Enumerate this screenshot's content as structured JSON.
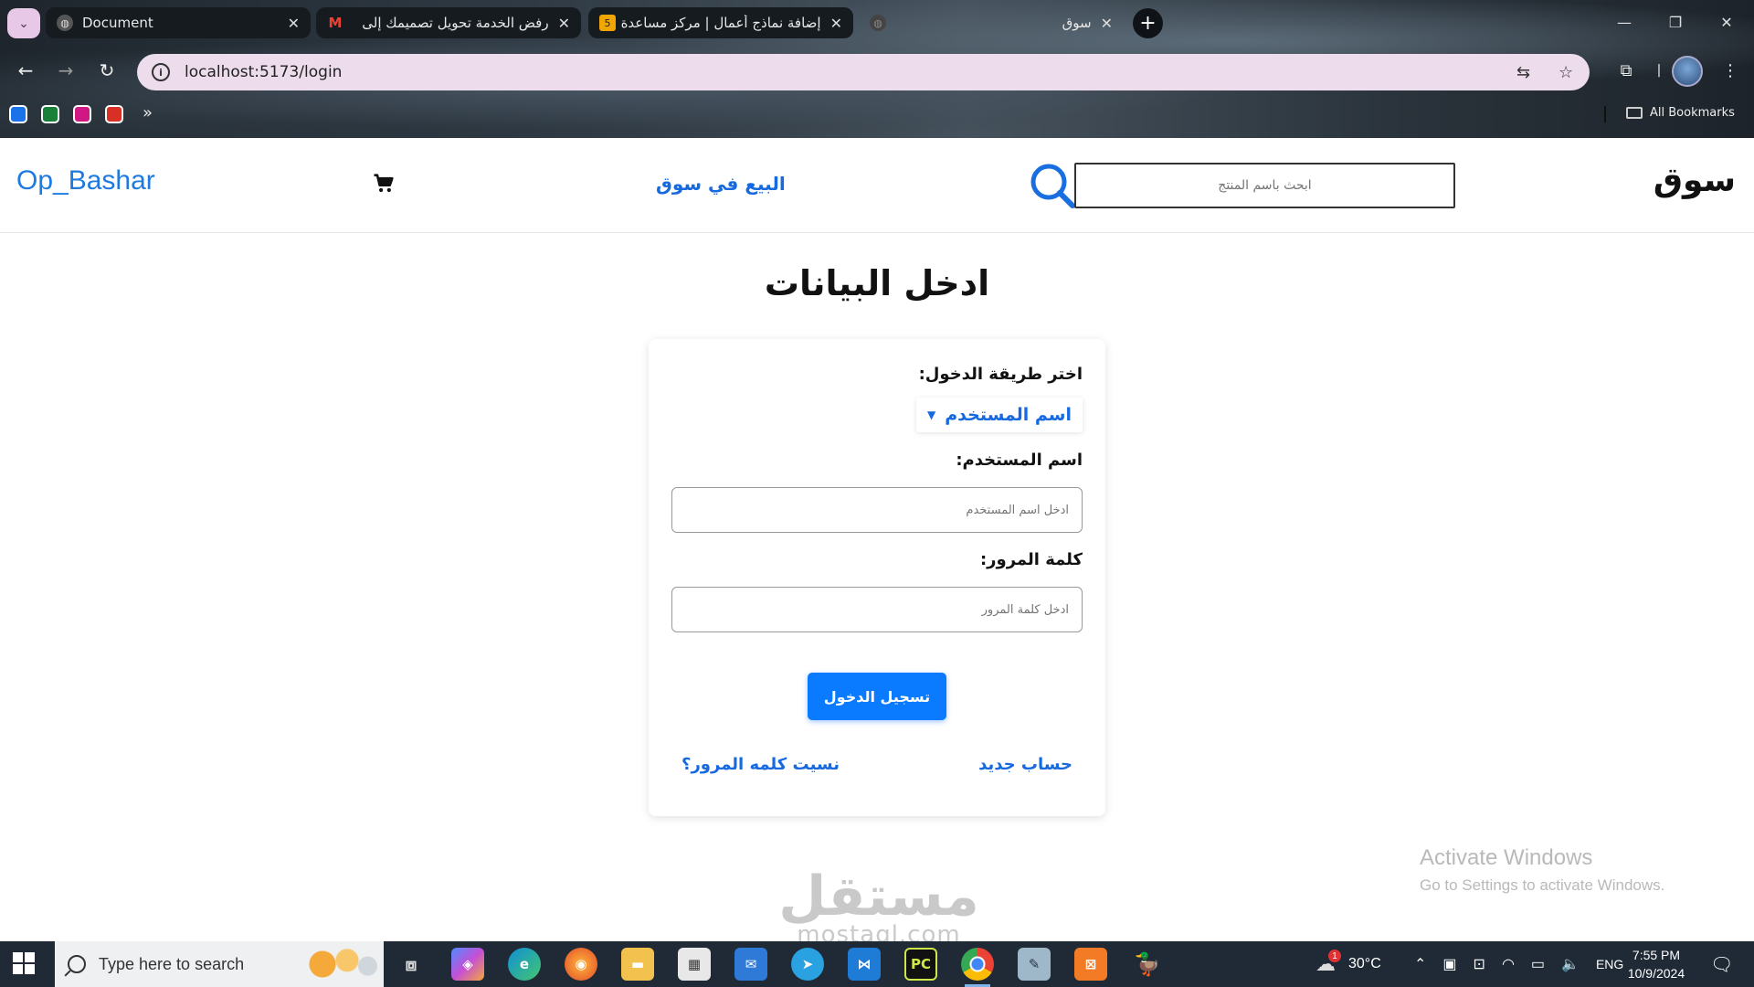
{
  "browser": {
    "tabs": [
      {
        "title": "Document",
        "favicon": "globe-icon"
      },
      {
        "title": "رفض الخدمة تحويل تصميمك إلى",
        "favicon": "gmail-icon"
      },
      {
        "title": "إضافة نماذج أعمال | مركز مساعدة",
        "favicon": "mostaql-icon",
        "badge": "5"
      },
      {
        "title": "سوق",
        "favicon": "globe-icon"
      }
    ],
    "url": "localhost:5173/login",
    "bookmarks_label": "All Bookmarks"
  },
  "header": {
    "brand": "Op_Bashar",
    "sell_link": "البيع في سوق",
    "search_placeholder": "ابحث باسم المنتج",
    "logo": "سوق"
  },
  "login": {
    "page_title": "ادخل البيانات",
    "method_label": "اختر طريقة الدخول:",
    "method_value": "اسم المستخدم",
    "username_label": "اسم المستخدم:",
    "username_placeholder": "ادخل اسم المستخدم",
    "password_label": "كلمة المرور:",
    "password_placeholder": "ادخل كلمة المرور",
    "submit": "تسجيل الدخول",
    "new_account": "حساب جديد",
    "forgot_password": "نسيت كلمه المرور؟"
  },
  "watermark": {
    "arabic": "مستقل",
    "latin": "mostaql.com"
  },
  "windows": {
    "activate_title": "Activate Windows",
    "activate_sub": "Go to Settings to activate Windows.",
    "search_placeholder": "Type here to search",
    "temperature": "30°C",
    "weather_badge": "1",
    "language": "ENG",
    "time": "7:55 PM",
    "date": "10/9/2024"
  },
  "colors": {
    "accent": "#1769e0",
    "button": "#0a7bff",
    "omnibox": "#ecdcec",
    "taskbar": "#1f2a36"
  }
}
